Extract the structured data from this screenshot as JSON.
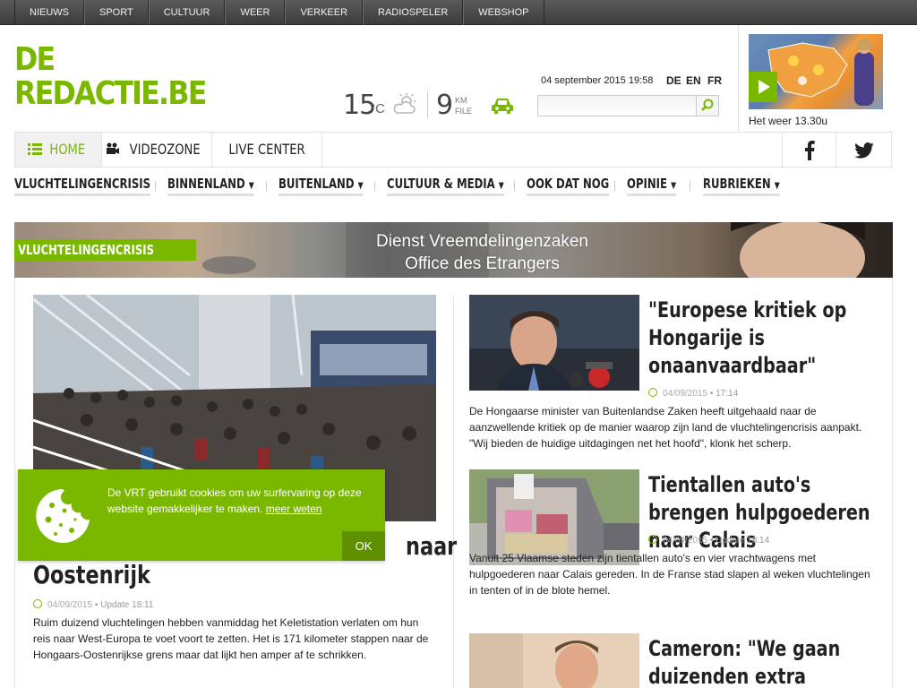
{
  "topnav": [
    "NIEUWS",
    "SPORT",
    "CULTUUR",
    "WEER",
    "VERKEER",
    "RADIOSPELER",
    "WEBSHOP"
  ],
  "logo": {
    "line1": "DE",
    "line2": "REDACTIE.BE"
  },
  "weather": {
    "temp": "15",
    "unit": "°C",
    "icon": "sun-cloud-icon"
  },
  "traffic": {
    "km": "9",
    "unit_line1": "KM",
    "unit_line2": "FILE",
    "icon": "car-icon"
  },
  "header": {
    "date": "04 september 2015 19:58",
    "languages": [
      "DE",
      "EN",
      "FR"
    ],
    "search_placeholder": ""
  },
  "weather_video": {
    "caption": "Het weer 13.30u"
  },
  "mainnav": {
    "home": "HOME",
    "video": "VIDEOZONE",
    "live": "LIVE CENTER",
    "facebook_icon": "facebook-icon",
    "twitter_icon": "twitter-icon"
  },
  "categories": [
    "VLUCHTELINGENCRISIS",
    "BINNENLAND",
    "BUITENLAND",
    "CULTUUR & MEDIA",
    "OOK DAT NOG",
    "OPINIE",
    "RUBRIEKEN"
  ],
  "banner": {
    "tag": "VLUCHTELINGENCRISIS",
    "line1": "Dienst Vreemdelingenzaken",
    "line2": "Office des Etrangers"
  },
  "main_article": {
    "title_line1": "naar",
    "title_line2": "Oostenrijk",
    "date": "04/09/2015",
    "update": "Update 18:11",
    "body": "Ruim duizend vluchtelingen hebben vanmiddag het Keletistation verlaten om hun reis naar West-Europa te voet voort te zetten. Het is 171 kilometer stappen naar de Hongaars-Oostenrijkse grens maar dat lijkt hen amper af te schrikken."
  },
  "side_articles": [
    {
      "title": "\"Europese kritiek op Hongarije is onaanvaardbaar\"",
      "date": "04/09/2015",
      "update": "17:14",
      "body": "De Hongaarse minister van Buitenlandse Zaken heeft uitgehaald naar de aanzwellende kritiek op de manier waarop zijn land de vluchtelingencrisis aanpakt. \"Wij bieden de huidige uitdagingen net het hoofd\", klonk het scherp."
    },
    {
      "title": "Tientallen auto's brengen hulpgoederen naar Calais",
      "date": "04/09/2015",
      "update": "Update 18:14",
      "body": "Vanuit 25 Vlaamse steden zijn tientallen auto's en vier vrachtwagens met hulpgoederen naar Calais gereden. In de Franse stad slapen al weken vluchtelingen in tenten of in de blote hemel."
    },
    {
      "title": "Cameron: \"We gaan duizenden extra Syrische",
      "date": "",
      "update": "",
      "body": ""
    }
  ],
  "cookie": {
    "text": "De VRT gebruikt cookies om uw surfervaring op deze website gemakkelijker te maken.",
    "link": "meer weten",
    "ok": "OK"
  }
}
